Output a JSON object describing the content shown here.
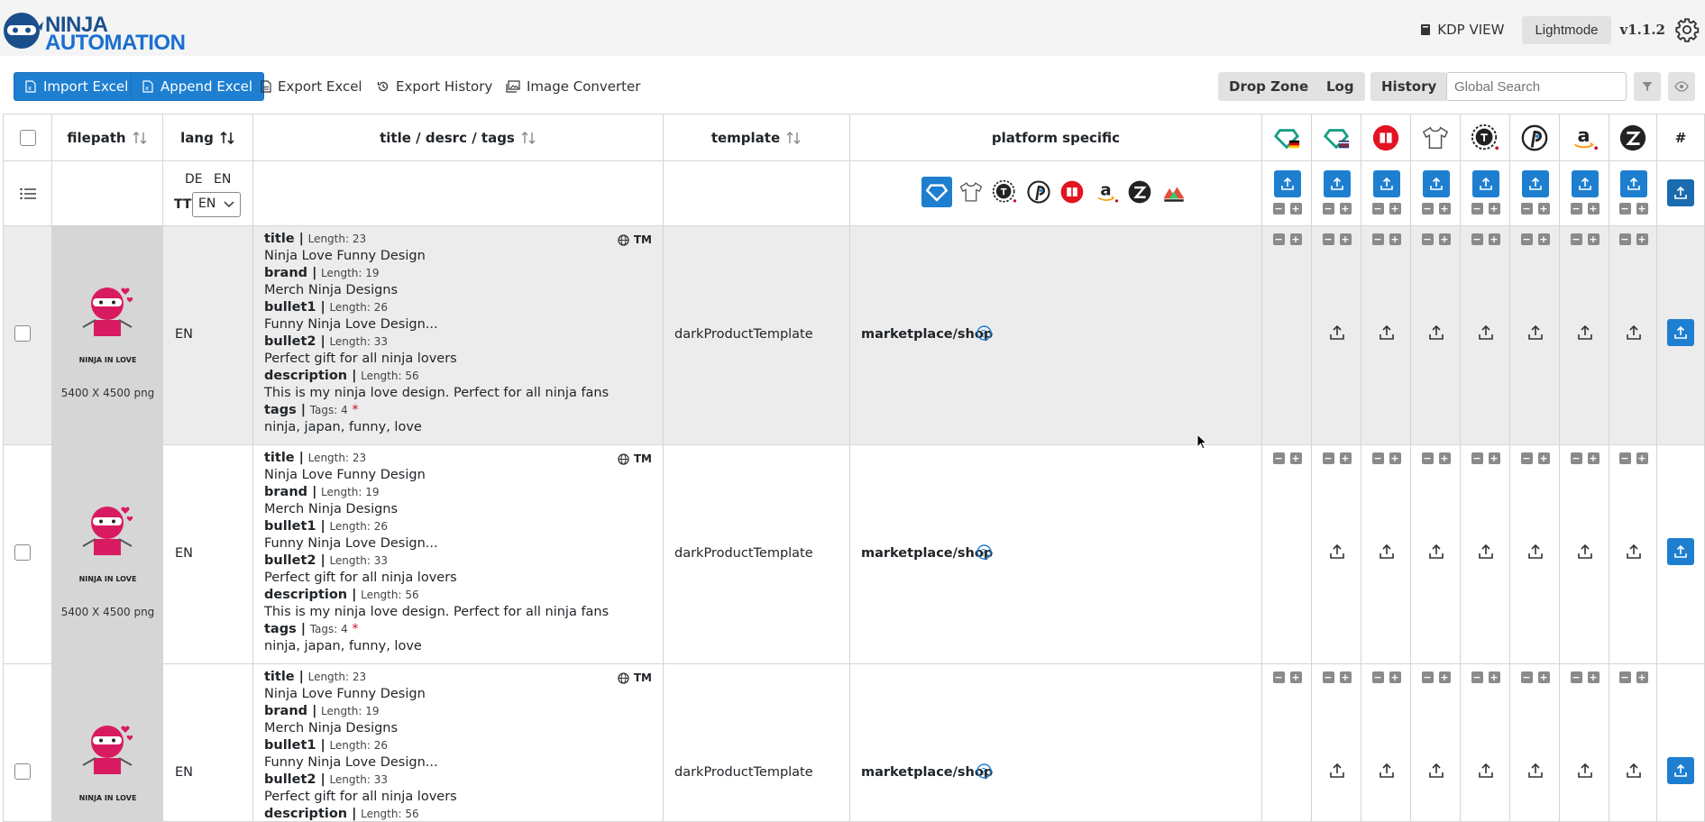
{
  "header": {
    "logo_line1": "NINJA",
    "logo_line2": "AUTOMATION",
    "kdp_view": "KDP VIEW",
    "lightmode": "Lightmode",
    "version": "v1.1.2"
  },
  "toolbar": {
    "import_excel": "Import Excel",
    "append_excel": "Append Excel",
    "export_excel": "Export Excel",
    "export_history": "Export History",
    "image_converter": "Image Converter",
    "drop_zone": "Drop Zone",
    "log": "Log",
    "history": "History",
    "search_placeholder": "Global Search"
  },
  "columns": {
    "filepath": "filepath",
    "lang": "lang",
    "title": "title / desrc / tags",
    "template": "template",
    "platform": "platform specific",
    "hash": "#"
  },
  "lang_filter": {
    "de": "DE",
    "en": "EN",
    "tt": "TT",
    "selected": "EN"
  },
  "platforms": [
    "spreadshirt-de-icon",
    "spreadshirt-us-icon",
    "redbubble-icon",
    "shirt-icon",
    "teepublic-icon",
    "pinterest-p-icon",
    "amazon-icon",
    "zazzle-icon"
  ],
  "colors": {
    "primary": "#1e7fd1",
    "header_bg": "#f4f4f4",
    "row_bg": "#ececec",
    "image_bg": "#d6d6d6",
    "required": "#c8102e"
  },
  "rows": [
    {
      "image_caption": "NINJA IN LOVE",
      "size": "5400 X 4500 png",
      "lang": "EN",
      "title_label": "title |",
      "title_len": "Length: 23",
      "title": "Ninja Love Funny Design",
      "brand_label": "brand |",
      "brand_len": "Length: 19",
      "brand": "Merch Ninja Designs",
      "bullet1_label": "bullet1 |",
      "bullet1_len": "Length: 26",
      "bullet1": "Funny Ninja Love Design...",
      "bullet2_label": "bullet2 |",
      "bullet2_len": "Length: 33",
      "bullet2": "Perfect gift for all ninja lovers",
      "desc_label": "description |",
      "desc_len": "Length: 56",
      "desc": "This is my ninja love design. Perfect for all ninja fans",
      "tags_label": "tags |",
      "tags_len": "Tags: 4",
      "tags": "ninja, japan, funny, love",
      "tm": "TM",
      "template": "darkProductTemplate",
      "platform": "marketplace/shop"
    },
    {
      "image_caption": "NINJA IN LOVE",
      "size": "5400 X 4500 png",
      "lang": "EN",
      "title_label": "title |",
      "title_len": "Length: 23",
      "title": "Ninja Love Funny Design",
      "brand_label": "brand |",
      "brand_len": "Length: 19",
      "brand": "Merch Ninja Designs",
      "bullet1_label": "bullet1 |",
      "bullet1_len": "Length: 26",
      "bullet1": "Funny Ninja Love Design...",
      "bullet2_label": "bullet2 |",
      "bullet2_len": "Length: 33",
      "bullet2": "Perfect gift for all ninja lovers",
      "desc_label": "description |",
      "desc_len": "Length: 56",
      "desc": "This is my ninja love design. Perfect for all ninja fans",
      "tags_label": "tags |",
      "tags_len": "Tags: 4",
      "tags": "ninja, japan, funny, love",
      "tm": "TM",
      "template": "darkProductTemplate",
      "platform": "marketplace/shop"
    },
    {
      "image_caption": "NINJA IN LOVE",
      "lang": "EN",
      "title_label": "title |",
      "title_len": "Length: 23",
      "title": "Ninja Love Funny Design",
      "brand_label": "brand |",
      "brand_len": "Length: 19",
      "brand": "Merch Ninja Designs",
      "bullet1_label": "bullet1 |",
      "bullet1_len": "Length: 26",
      "bullet1": "Funny Ninja Love Design...",
      "bullet2_label": "bullet2 |",
      "bullet2_len": "Length: 33",
      "bullet2": "Perfect gift for all ninja lovers",
      "desc_label": "description |",
      "desc_len": "Length: 56",
      "tm": "TM",
      "template": "darkProductTemplate",
      "platform": "marketplace/shop"
    }
  ]
}
